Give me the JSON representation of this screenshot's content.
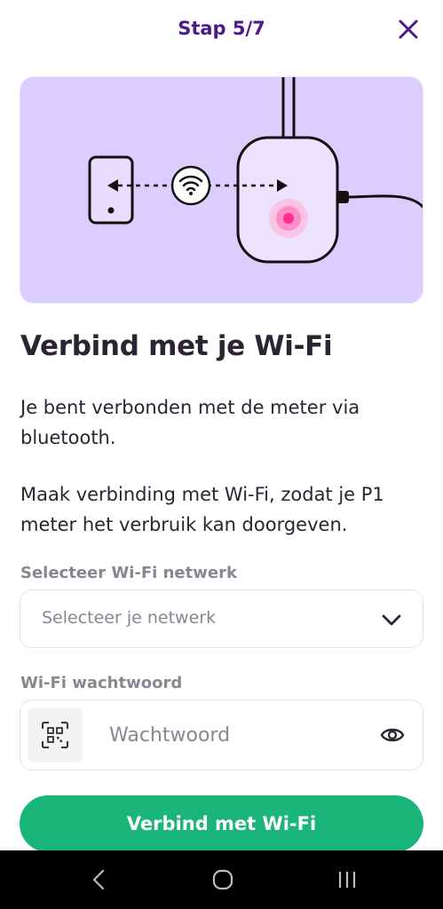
{
  "header": {
    "step": "Stap 5/7",
    "close_icon": "close-icon"
  },
  "illustration": {
    "description_icon": "phone-wifi-meter-illustration",
    "colors": {
      "background": "#dccdff",
      "pulse": "#ff3d9a"
    }
  },
  "content": {
    "title": "Verbind met je Wi-Fi",
    "paragraph1": "Je bent verbonden met de meter via bluetooth.",
    "paragraph2": "Maak verbinding met Wi-Fi, zodat je P1 meter het verbruik kan doorgeven."
  },
  "network": {
    "label": "Selecteer Wi-Fi netwerk",
    "placeholder": "Selecteer je netwerk",
    "icon": "chevron-down-icon"
  },
  "password": {
    "label": "Wi-Fi wachtwoord",
    "placeholder": "Wachtwoord",
    "value": "",
    "qr_icon": "qr-scan-icon",
    "eye_icon": "eye-icon"
  },
  "actions": {
    "connect_label": "Verbind met Wi-Fi"
  },
  "colors": {
    "accent": "#4b1a8c",
    "primary_button": "#1ab679",
    "text": "#2b2533",
    "muted": "#8a8590"
  },
  "system_nav": {
    "back_icon": "back-icon",
    "home_icon": "home-icon",
    "recents_icon": "recents-icon"
  }
}
